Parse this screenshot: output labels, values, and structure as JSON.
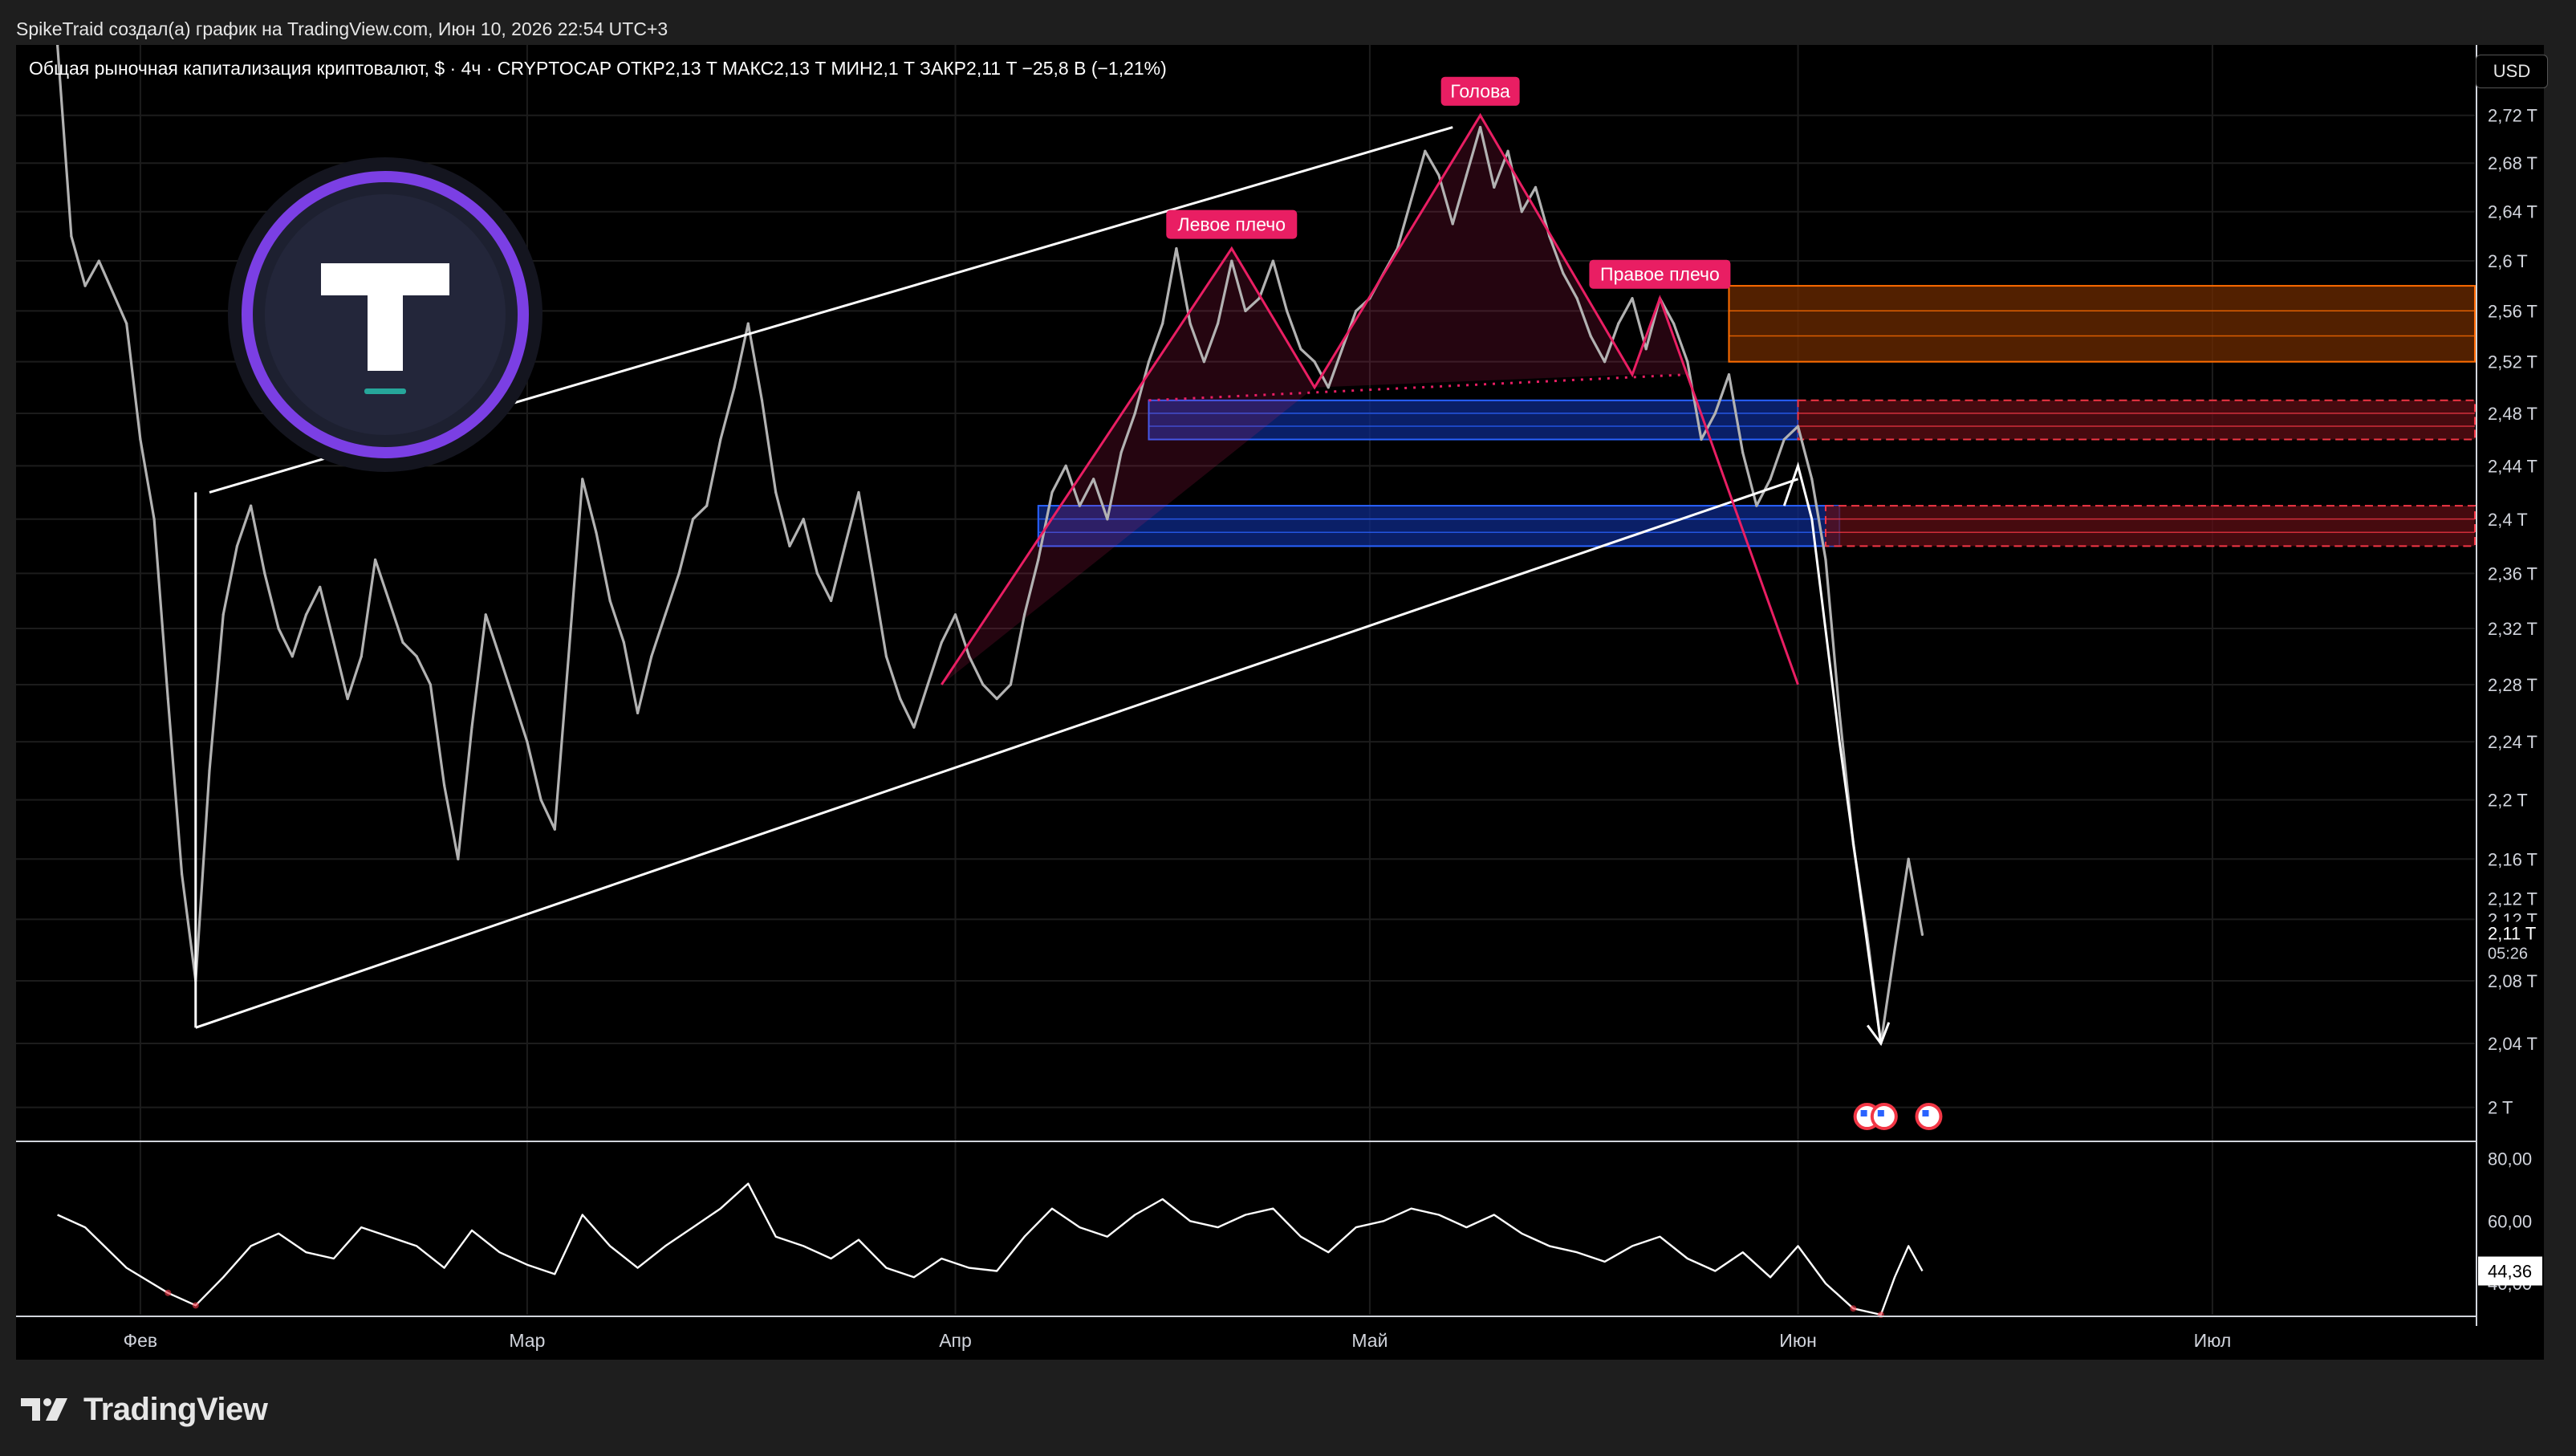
{
  "header": {
    "publisher_line": "SpikeTraid создал(а) график на TradingView.com, Июн 10, 2026 22:54 UTC+3",
    "symbol_legend": "Общая рыночная капитализация криптовалют, $ · 4ч · CRYPTOCAP  ОТКР2,13 T  МАКС2,13 T  МИН2,1 T  ЗАКР2,11 T  −25,8 B (−1,21%)",
    "currency_button": "USD"
  },
  "brand": {
    "name": "TradingView"
  },
  "colors": {
    "price": "#b2b2b2",
    "channel": "#ffffff",
    "pattern": "#e91e63",
    "blue_zone": "#2962ff",
    "orange_zone": "#ff6d00",
    "red_zone": "#f23645",
    "rsi": "#ffffff"
  },
  "chart_data": [
    {
      "type": "line",
      "pane": "price",
      "x_axis": {
        "ticks": [
          "Фев",
          "Мар",
          "Апр",
          "Май",
          "Июн",
          "Июл"
        ]
      },
      "y_axis": {
        "scale": "log",
        "ylim": [
          1.98,
          2.78
        ],
        "unit_suffix": "T",
        "ticks": [
          "2,72 T",
          "2,68 T",
          "2,64 T",
          "2,6 T",
          "2,56 T",
          "2,52 T",
          "2,48 T",
          "2,44 T",
          "2,4 T",
          "2,36 T",
          "2,32 T",
          "2,28 T",
          "2,24 T",
          "2,2 T",
          "2,16 T",
          "2,12 T",
          "2,08 T",
          "2,04 T",
          "2 T"
        ]
      },
      "last_price": {
        "label": "2,11 T",
        "countdown": "05:26",
        "prev_label": "2,12 T"
      },
      "series": [
        {
          "key": "price",
          "points": [
            [
              "2026-01-26",
              2.78
            ],
            [
              "2026-01-27",
              2.62
            ],
            [
              "2026-01-28",
              2.58
            ],
            [
              "2026-01-29",
              2.6
            ],
            [
              "2026-01-31",
              2.55
            ],
            [
              "2026-02-01",
              2.46
            ],
            [
              "2026-02-02",
              2.4
            ],
            [
              "2026-02-03",
              2.27
            ],
            [
              "2026-02-04",
              2.15
            ],
            [
              "2026-02-05",
              2.08
            ],
            [
              "2026-02-06",
              2.22
            ],
            [
              "2026-02-07",
              2.33
            ],
            [
              "2026-02-08",
              2.38
            ],
            [
              "2026-02-09",
              2.41
            ],
            [
              "2026-02-10",
              2.36
            ],
            [
              "2026-02-11",
              2.32
            ],
            [
              "2026-02-12",
              2.3
            ],
            [
              "2026-02-13",
              2.33
            ],
            [
              "2026-02-14",
              2.35
            ],
            [
              "2026-02-15",
              2.31
            ],
            [
              "2026-02-16",
              2.27
            ],
            [
              "2026-02-17",
              2.3
            ],
            [
              "2026-02-18",
              2.37
            ],
            [
              "2026-02-19",
              2.34
            ],
            [
              "2026-02-20",
              2.31
            ],
            [
              "2026-02-21",
              2.3
            ],
            [
              "2026-02-22",
              2.28
            ],
            [
              "2026-02-23",
              2.21
            ],
            [
              "2026-02-24",
              2.16
            ],
            [
              "2026-02-25",
              2.25
            ],
            [
              "2026-02-26",
              2.33
            ],
            [
              "2026-02-27",
              2.3
            ],
            [
              "2026-02-28",
              2.27
            ],
            [
              "2026-03-01",
              2.24
            ],
            [
              "2026-03-02",
              2.2
            ],
            [
              "2026-03-03",
              2.18
            ],
            [
              "2026-03-04",
              2.3
            ],
            [
              "2026-03-05",
              2.43
            ],
            [
              "2026-03-06",
              2.39
            ],
            [
              "2026-03-07",
              2.34
            ],
            [
              "2026-03-08",
              2.31
            ],
            [
              "2026-03-09",
              2.26
            ],
            [
              "2026-03-10",
              2.3
            ],
            [
              "2026-03-11",
              2.33
            ],
            [
              "2026-03-12",
              2.36
            ],
            [
              "2026-03-13",
              2.4
            ],
            [
              "2026-03-14",
              2.41
            ],
            [
              "2026-03-15",
              2.46
            ],
            [
              "2026-03-16",
              2.5
            ],
            [
              "2026-03-17",
              2.55
            ],
            [
              "2026-03-18",
              2.49
            ],
            [
              "2026-03-19",
              2.42
            ],
            [
              "2026-03-20",
              2.38
            ],
            [
              "2026-03-21",
              2.4
            ],
            [
              "2026-03-22",
              2.36
            ],
            [
              "2026-03-23",
              2.34
            ],
            [
              "2026-03-24",
              2.38
            ],
            [
              "2026-03-25",
              2.42
            ],
            [
              "2026-03-26",
              2.36
            ],
            [
              "2026-03-27",
              2.3
            ],
            [
              "2026-03-28",
              2.27
            ],
            [
              "2026-03-29",
              2.25
            ],
            [
              "2026-03-30",
              2.28
            ],
            [
              "2026-03-31",
              2.31
            ],
            [
              "2026-04-01",
              2.33
            ],
            [
              "2026-04-02",
              2.3
            ],
            [
              "2026-04-03",
              2.28
            ],
            [
              "2026-04-04",
              2.27
            ],
            [
              "2026-04-05",
              2.28
            ],
            [
              "2026-04-06",
              2.33
            ],
            [
              "2026-04-07",
              2.37
            ],
            [
              "2026-04-08",
              2.42
            ],
            [
              "2026-04-09",
              2.44
            ],
            [
              "2026-04-10",
              2.41
            ],
            [
              "2026-04-11",
              2.43
            ],
            [
              "2026-04-12",
              2.4
            ],
            [
              "2026-04-13",
              2.45
            ],
            [
              "2026-04-14",
              2.48
            ],
            [
              "2026-04-15",
              2.52
            ],
            [
              "2026-04-16",
              2.55
            ],
            [
              "2026-04-17",
              2.61
            ],
            [
              "2026-04-18",
              2.55
            ],
            [
              "2026-04-19",
              2.52
            ],
            [
              "2026-04-20",
              2.55
            ],
            [
              "2026-04-21",
              2.6
            ],
            [
              "2026-04-22",
              2.56
            ],
            [
              "2026-04-23",
              2.57
            ],
            [
              "2026-04-24",
              2.6
            ],
            [
              "2026-04-25",
              2.56
            ],
            [
              "2026-04-26",
              2.53
            ],
            [
              "2026-04-27",
              2.52
            ],
            [
              "2026-04-28",
              2.5
            ],
            [
              "2026-04-29",
              2.53
            ],
            [
              "2026-04-30",
              2.56
            ],
            [
              "2026-05-01",
              2.57
            ],
            [
              "2026-05-02",
              2.59
            ],
            [
              "2026-05-03",
              2.61
            ],
            [
              "2026-05-04",
              2.65
            ],
            [
              "2026-05-05",
              2.69
            ],
            [
              "2026-05-06",
              2.67
            ],
            [
              "2026-05-07",
              2.63
            ],
            [
              "2026-05-08",
              2.67
            ],
            [
              "2026-05-09",
              2.71
            ],
            [
              "2026-05-10",
              2.66
            ],
            [
              "2026-05-11",
              2.69
            ],
            [
              "2026-05-12",
              2.64
            ],
            [
              "2026-05-13",
              2.66
            ],
            [
              "2026-05-14",
              2.62
            ],
            [
              "2026-05-15",
              2.59
            ],
            [
              "2026-05-16",
              2.57
            ],
            [
              "2026-05-17",
              2.54
            ],
            [
              "2026-05-18",
              2.52
            ],
            [
              "2026-05-19",
              2.55
            ],
            [
              "2026-05-20",
              2.57
            ],
            [
              "2026-05-21",
              2.53
            ],
            [
              "2026-05-22",
              2.57
            ],
            [
              "2026-05-23",
              2.55
            ],
            [
              "2026-05-24",
              2.52
            ],
            [
              "2026-05-25",
              2.46
            ],
            [
              "2026-05-26",
              2.48
            ],
            [
              "2026-05-27",
              2.51
            ],
            [
              "2026-05-28",
              2.45
            ],
            [
              "2026-05-29",
              2.41
            ],
            [
              "2026-05-30",
              2.43
            ],
            [
              "2026-05-31",
              2.46
            ],
            [
              "2026-06-01",
              2.47
            ],
            [
              "2026-06-02",
              2.43
            ],
            [
              "2026-06-03",
              2.37
            ],
            [
              "2026-06-04",
              2.26
            ],
            [
              "2026-06-05",
              2.17
            ],
            [
              "2026-06-06",
              2.11
            ],
            [
              "2026-06-07",
              2.04
            ],
            [
              "2026-06-08",
              2.1
            ],
            [
              "2026-06-09",
              2.16
            ],
            [
              "2026-06-10",
              2.11
            ]
          ]
        }
      ],
      "annotations": {
        "labels": [
          "Левое плечо",
          "Голова",
          "Правое плечо"
        ],
        "channel": [
          {
            "from": [
              "2026-02-06",
              2.42
            ],
            "to": [
              "2026-05-07",
              2.71
            ]
          },
          {
            "from": [
              "2026-02-05",
              2.05
            ],
            "to": [
              "2026-06-01",
              2.43
            ]
          },
          {
            "from": [
              "2026-02-05",
              2.42
            ],
            "to": [
              "2026-02-05",
              2.05
            ]
          }
        ],
        "head_and_shoulders_points": [
          [
            "2026-03-31",
            2.28
          ],
          [
            "2026-04-21",
            2.61
          ],
          [
            "2026-04-27",
            2.5
          ],
          [
            "2026-05-09",
            2.72
          ],
          [
            "2026-05-20",
            2.51
          ],
          [
            "2026-05-22",
            2.57
          ],
          [
            "2026-06-01",
            2.28
          ]
        ],
        "neckline": {
          "from": [
            "2026-04-15",
            2.49
          ],
          "to": [
            "2026-05-24",
            2.51
          ]
        },
        "zones": [
          {
            "color": "blue",
            "from": "2026-04-15",
            "to": "2026-06-01",
            "low": 2.46,
            "high": 2.49
          },
          {
            "color": "blue",
            "from": "2026-04-07",
            "to": "2026-06-04",
            "low": 2.38,
            "high": 2.41
          },
          {
            "color": "orange",
            "from": "2026-05-27",
            "to": "2026-07-20",
            "low": 2.52,
            "high": 2.58
          },
          {
            "color": "red",
            "from": "2026-06-01",
            "to": "2026-07-20",
            "low": 2.46,
            "high": 2.49
          },
          {
            "color": "red",
            "from": "2026-06-03",
            "to": "2026-07-20",
            "low": 2.38,
            "high": 2.41
          }
        ],
        "projection_path": [
          [
            "2026-05-31",
            2.41
          ],
          [
            "2026-06-01",
            2.44
          ],
          [
            "2026-06-02",
            2.4
          ],
          [
            "2026-06-04",
            2.24
          ],
          [
            "2026-06-07",
            2.04
          ]
        ]
      }
    },
    {
      "type": "line",
      "pane": "rsi",
      "y_axis": {
        "ylim": [
          30,
          85
        ],
        "ticks": [
          "80,00",
          "60,00",
          "40,00"
        ]
      },
      "last_value_label": "44,36",
      "series": [
        {
          "key": "rsi",
          "points": [
            [
              "2026-01-26",
              62
            ],
            [
              "2026-01-28",
              58
            ],
            [
              "2026-01-31",
              45
            ],
            [
              "2026-02-03",
              37
            ],
            [
              "2026-02-05",
              33
            ],
            [
              "2026-02-07",
              42
            ],
            [
              "2026-02-09",
              52
            ],
            [
              "2026-02-11",
              56
            ],
            [
              "2026-02-13",
              50
            ],
            [
              "2026-02-15",
              48
            ],
            [
              "2026-02-17",
              58
            ],
            [
              "2026-02-19",
              55
            ],
            [
              "2026-02-21",
              52
            ],
            [
              "2026-02-23",
              45
            ],
            [
              "2026-02-25",
              57
            ],
            [
              "2026-02-27",
              50
            ],
            [
              "2026-03-01",
              46
            ],
            [
              "2026-03-03",
              43
            ],
            [
              "2026-03-05",
              62
            ],
            [
              "2026-03-07",
              52
            ],
            [
              "2026-03-09",
              45
            ],
            [
              "2026-03-11",
              52
            ],
            [
              "2026-03-13",
              58
            ],
            [
              "2026-03-15",
              64
            ],
            [
              "2026-03-17",
              72
            ],
            [
              "2026-03-19",
              55
            ],
            [
              "2026-03-21",
              52
            ],
            [
              "2026-03-23",
              48
            ],
            [
              "2026-03-25",
              54
            ],
            [
              "2026-03-27",
              45
            ],
            [
              "2026-03-29",
              42
            ],
            [
              "2026-03-31",
              48
            ],
            [
              "2026-04-02",
              45
            ],
            [
              "2026-04-04",
              44
            ],
            [
              "2026-04-06",
              55
            ],
            [
              "2026-04-08",
              64
            ],
            [
              "2026-04-10",
              58
            ],
            [
              "2026-04-12",
              55
            ],
            [
              "2026-04-14",
              62
            ],
            [
              "2026-04-16",
              67
            ],
            [
              "2026-04-18",
              60
            ],
            [
              "2026-04-20",
              58
            ],
            [
              "2026-04-22",
              62
            ],
            [
              "2026-04-24",
              64
            ],
            [
              "2026-04-26",
              55
            ],
            [
              "2026-04-28",
              50
            ],
            [
              "2026-04-30",
              58
            ],
            [
              "2026-05-02",
              60
            ],
            [
              "2026-05-04",
              64
            ],
            [
              "2026-05-06",
              62
            ],
            [
              "2026-05-08",
              58
            ],
            [
              "2026-05-10",
              62
            ],
            [
              "2026-05-12",
              56
            ],
            [
              "2026-05-14",
              52
            ],
            [
              "2026-05-16",
              50
            ],
            [
              "2026-05-18",
              47
            ],
            [
              "2026-05-20",
              52
            ],
            [
              "2026-05-22",
              55
            ],
            [
              "2026-05-24",
              48
            ],
            [
              "2026-05-26",
              44
            ],
            [
              "2026-05-28",
              50
            ],
            [
              "2026-05-30",
              42
            ],
            [
              "2026-06-01",
              52
            ],
            [
              "2026-06-03",
              40
            ],
            [
              "2026-06-05",
              32
            ],
            [
              "2026-06-07",
              30
            ],
            [
              "2026-06-08",
              42
            ],
            [
              "2026-06-09",
              52
            ],
            [
              "2026-06-10",
              44
            ]
          ]
        }
      ]
    }
  ]
}
